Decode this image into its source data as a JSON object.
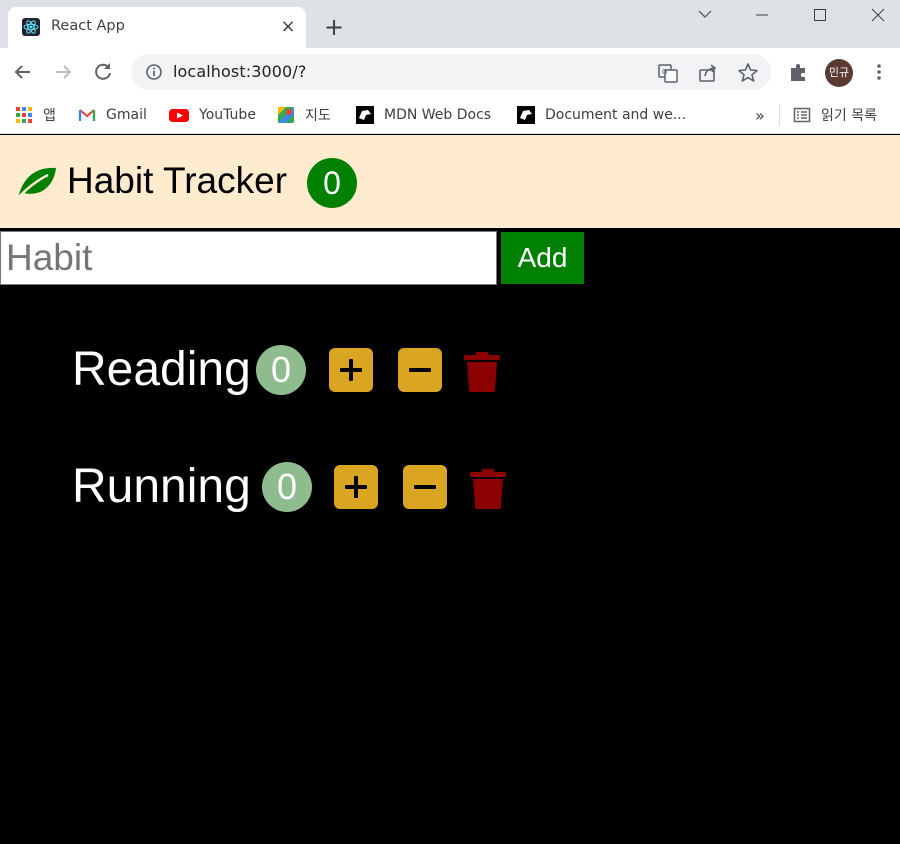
{
  "browser": {
    "tab_title": "React App",
    "tab_close": "×",
    "new_tab": "+",
    "url": "localhost:3000/?",
    "avatar_text": "민규",
    "bookmarks": [
      {
        "label": "앱",
        "icon": "apps-grid-icon"
      },
      {
        "label": "Gmail",
        "icon": "gmail-icon"
      },
      {
        "label": "YouTube",
        "icon": "youtube-icon"
      },
      {
        "label": "지도",
        "icon": "maps-icon"
      },
      {
        "label": "MDN Web Docs",
        "icon": "mdn-icon"
      },
      {
        "label": "Document and we...",
        "icon": "mdn-icon"
      }
    ],
    "overflow": "»",
    "reading_list": "읽기 목록"
  },
  "app": {
    "title": "Habit Tracker",
    "total_count": "0",
    "colors": {
      "header_bg": "#ffebcd",
      "accent": "#008000",
      "action": "#daa520",
      "trash": "#8b0000",
      "count_bg": "#8fbc8f"
    },
    "form": {
      "placeholder": "Habit",
      "value": "",
      "add_label": "Add"
    },
    "habits": [
      {
        "name": "Reading",
        "count": "0"
      },
      {
        "name": "Running",
        "count": "0"
      }
    ]
  }
}
